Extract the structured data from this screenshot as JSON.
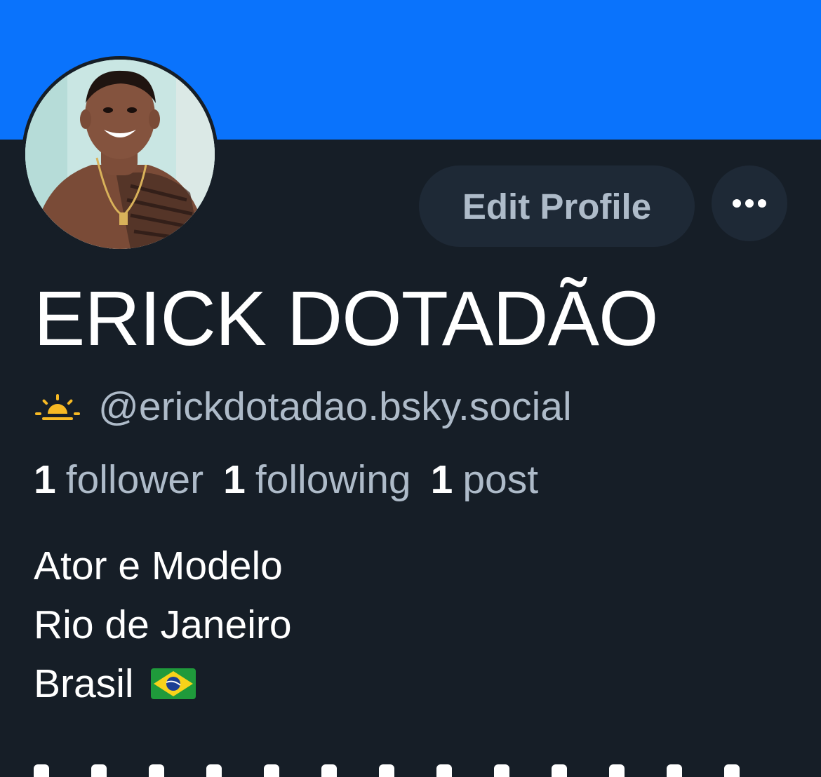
{
  "banner": {
    "color": "#0a73fc"
  },
  "avatar": {
    "alt": "profile-photo"
  },
  "actions": {
    "edit_profile_label": "Edit Profile",
    "more_icon": "ellipsis-icon"
  },
  "profile": {
    "display_name": "ERICK DOTADÃO",
    "handle": "@erickdotadao.bsky.social",
    "handle_icon": "sunrise-icon"
  },
  "stats": [
    {
      "count": "1",
      "label": "follower"
    },
    {
      "count": "1",
      "label": "following"
    },
    {
      "count": "1",
      "label": "post"
    }
  ],
  "bio": {
    "lines": [
      "Ator e Modelo",
      "Rio de Janeiro",
      "Brasil"
    ],
    "flag_icon": "brazil-flag-icon"
  },
  "colors": {
    "background": "#161e27",
    "button_bg": "#1e2936",
    "muted_text": "#aebbc9",
    "primary_text": "#ffffff",
    "sun": "#f6b924"
  }
}
